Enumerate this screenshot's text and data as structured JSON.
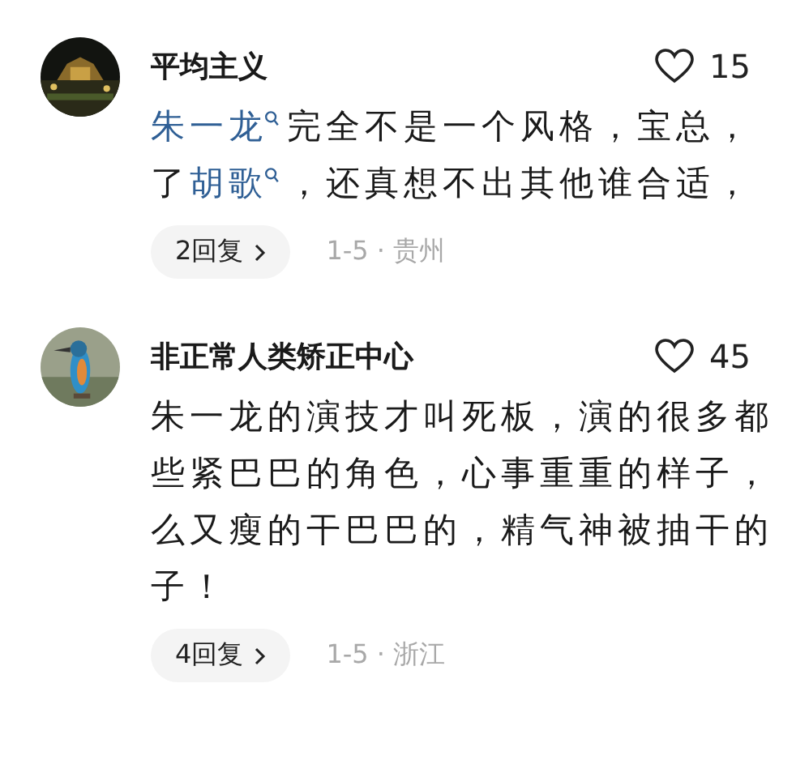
{
  "comments": [
    {
      "avatar": {
        "kind": "picture"
      },
      "author": "平均主义",
      "likes": "15",
      "lines": [
        [
          {
            "kind": "link",
            "text": "朱一龙"
          },
          {
            "kind": "text",
            "text": "完全不是一个风格，宝总，"
          }
        ],
        [
          {
            "kind": "text",
            "text": "了"
          },
          {
            "kind": "link",
            "text": "胡歌"
          },
          {
            "kind": "text",
            "text": "，还真想不出其他谁合适，"
          }
        ]
      ],
      "replies": "2回复",
      "meta": "1-5 · 贵州"
    },
    {
      "avatar": {
        "kind": "picture"
      },
      "author": "非正常人类矫正中心",
      "likes": "45",
      "lines": [
        [
          {
            "kind": "text",
            "text": "朱一龙的演技才叫死板，演的很多都"
          }
        ],
        [
          {
            "kind": "text",
            "text": "些紧巴巴的角色，心事重重的样子，"
          }
        ],
        [
          {
            "kind": "text",
            "text": "么又瘦的干巴巴的，精气神被抽干的"
          }
        ],
        [
          {
            "kind": "text",
            "text": "子！"
          }
        ]
      ],
      "replies": "4回复",
      "meta": "1-5 · 浙江"
    }
  ]
}
